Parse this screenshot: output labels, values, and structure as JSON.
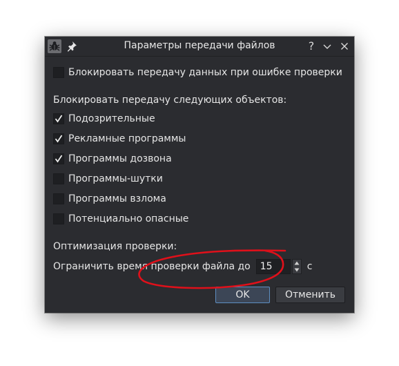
{
  "window": {
    "title": "Параметры передачи файлов",
    "help_glyph": "?",
    "minimize_glyph": "⌄",
    "close_glyph": "✕"
  },
  "options": {
    "block_on_error": {
      "label": "Блокировать передачу данных при ошибке проверки",
      "checked": false
    },
    "block_objects_heading": "Блокировать передачу следующих объектов:",
    "objects": [
      {
        "label": "Подозрительные",
        "checked": true
      },
      {
        "label": "Рекламные программы",
        "checked": true
      },
      {
        "label": "Программы дозвона",
        "checked": true
      },
      {
        "label": "Программы-шутки",
        "checked": false
      },
      {
        "label": "Программы взлома",
        "checked": false
      },
      {
        "label": "Потенциально опасные",
        "checked": false
      }
    ]
  },
  "optimization": {
    "heading": "Оптимизация проверки:",
    "limit_label": "Ограничить время проверки файла до",
    "limit_value": "15",
    "unit": "с"
  },
  "buttons": {
    "ok": "OK",
    "cancel": "Отменить"
  },
  "colors": {
    "dialog_bg": "#2b2c30",
    "ok_border": "#5e8fc2",
    "annotation": "#e0101a"
  },
  "icons": {
    "app": "bug-icon",
    "pin": "pin-icon"
  }
}
